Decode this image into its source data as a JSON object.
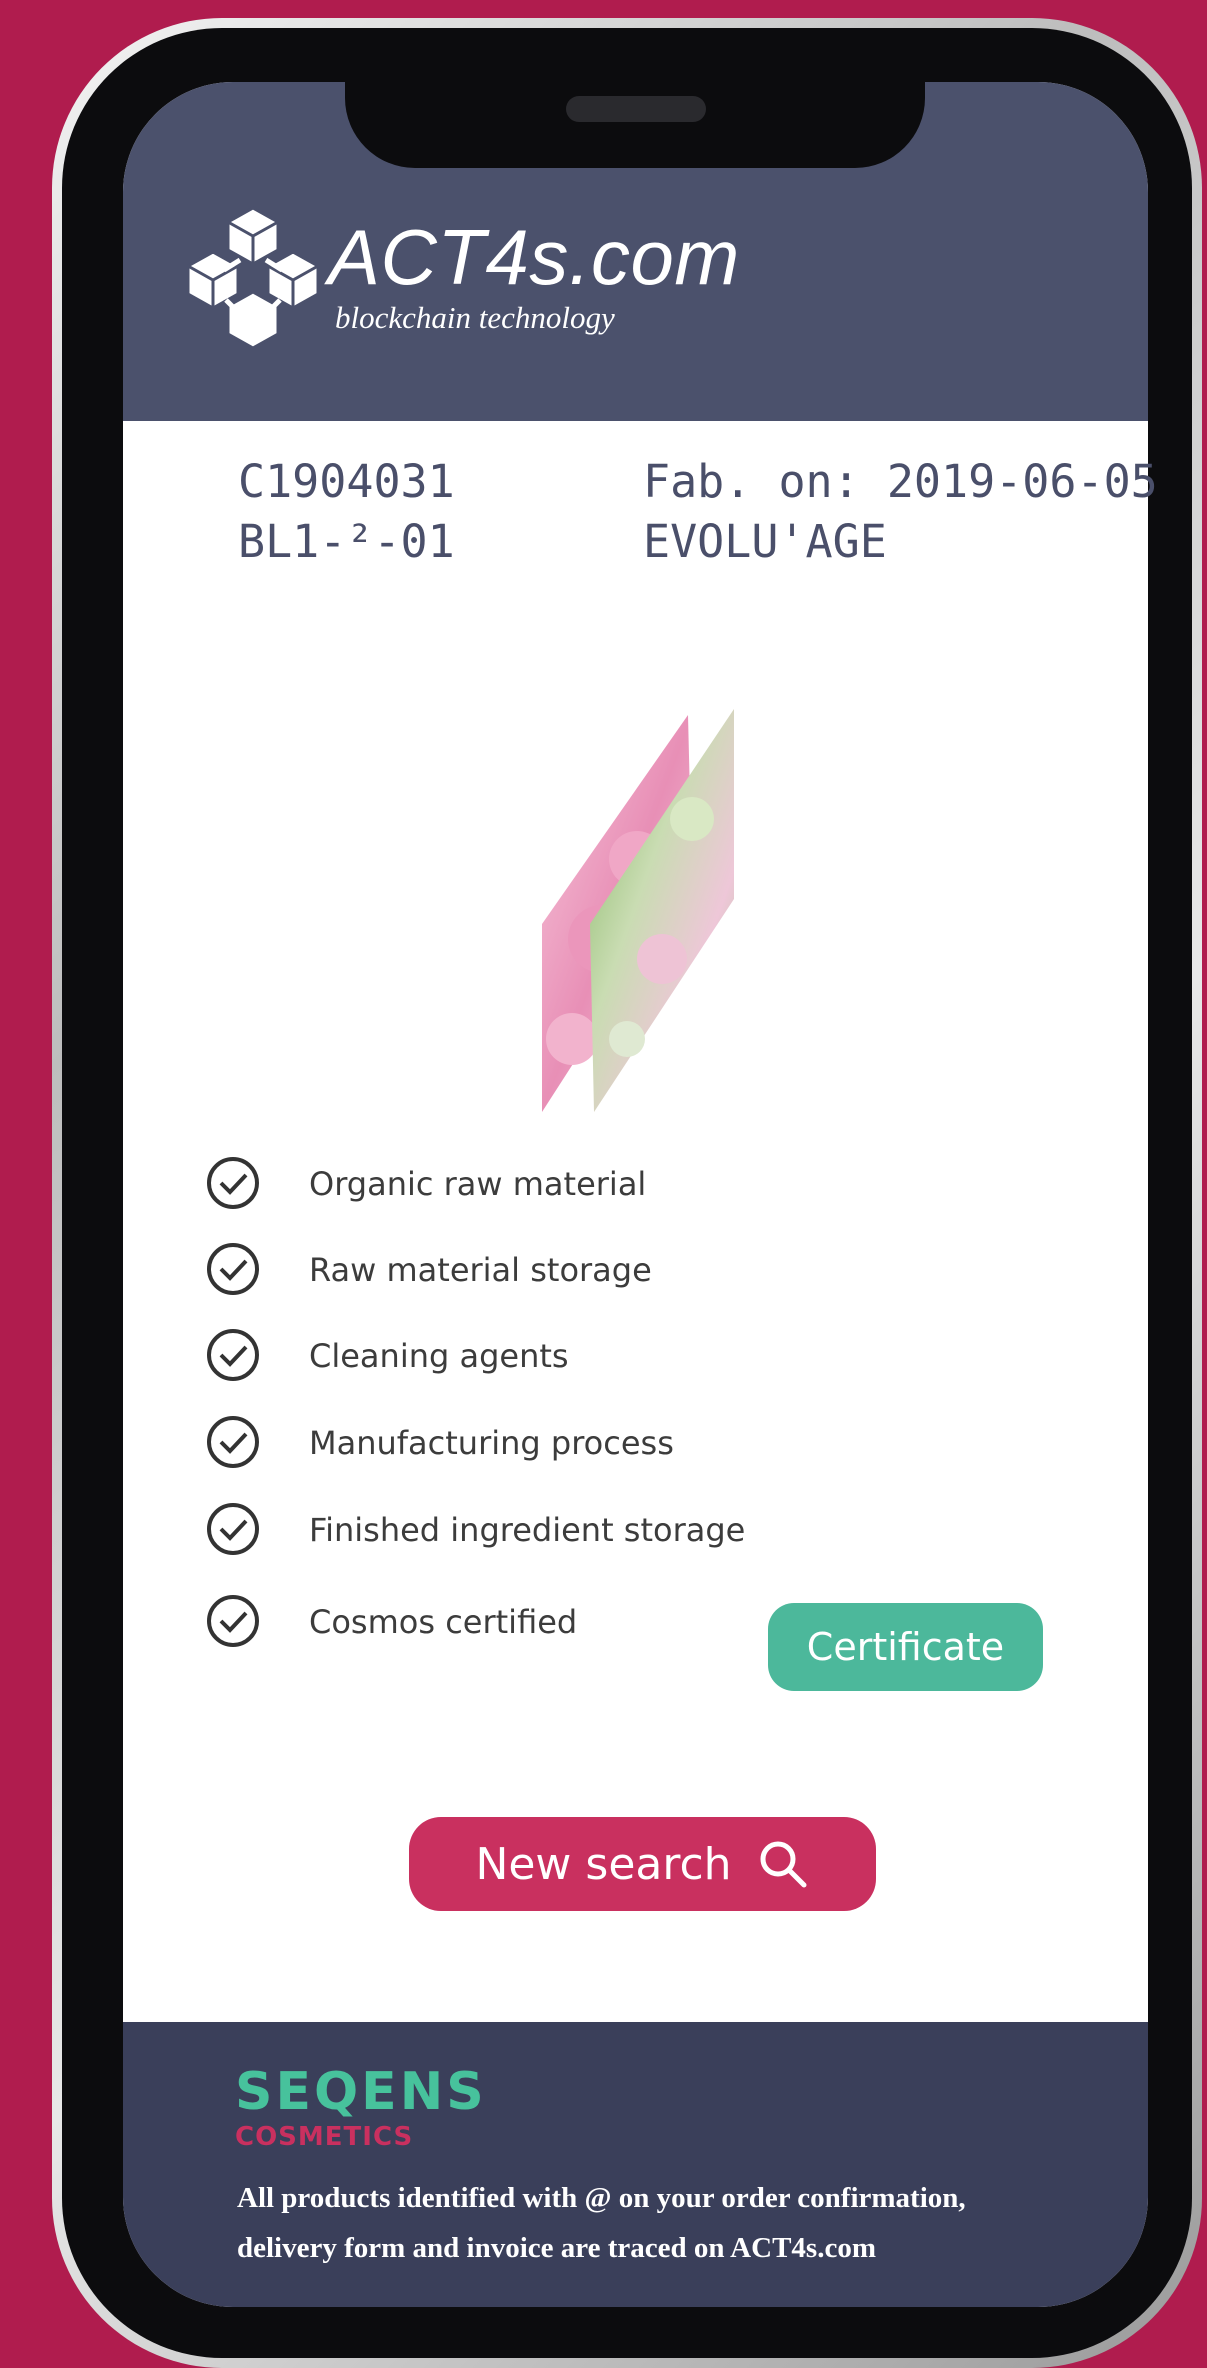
{
  "header": {
    "brand_title": "ACT4s.com",
    "brand_subtitle": "blockchain technology"
  },
  "product": {
    "code": "C1904031",
    "batch": "BL1-²-01",
    "fab_date": "Fab. on: 2019-06-05",
    "name": "EVOLU'AGE"
  },
  "checklist": [
    {
      "label": "Organic raw material",
      "checked": true
    },
    {
      "label": "Raw material storage",
      "checked": true
    },
    {
      "label": "Cleaning agents",
      "checked": true
    },
    {
      "label": "Manufacturing process",
      "checked": true
    },
    {
      "label": "Finished ingredient storage",
      "checked": true
    },
    {
      "label": "Cosmos certified",
      "checked": true
    }
  ],
  "buttons": {
    "certificate": "Certificate",
    "new_search": "New search"
  },
  "footer": {
    "brand_name": "SEQENS",
    "brand_sub": "COSMETICS",
    "note": "All products identified with @ on your order confirmation, delivery form and invoice are traced on ACT4s.com"
  },
  "icons": {
    "logo": "hexagon-cube-logo-icon",
    "check": "check-circle-icon",
    "search": "search-icon"
  },
  "colors": {
    "background": "#b01c4e",
    "header": "#4b516c",
    "footer": "#3a3f5a",
    "certificate_button": "#4cb89b",
    "search_button": "#c9305f",
    "brand_green": "#47c29c"
  }
}
